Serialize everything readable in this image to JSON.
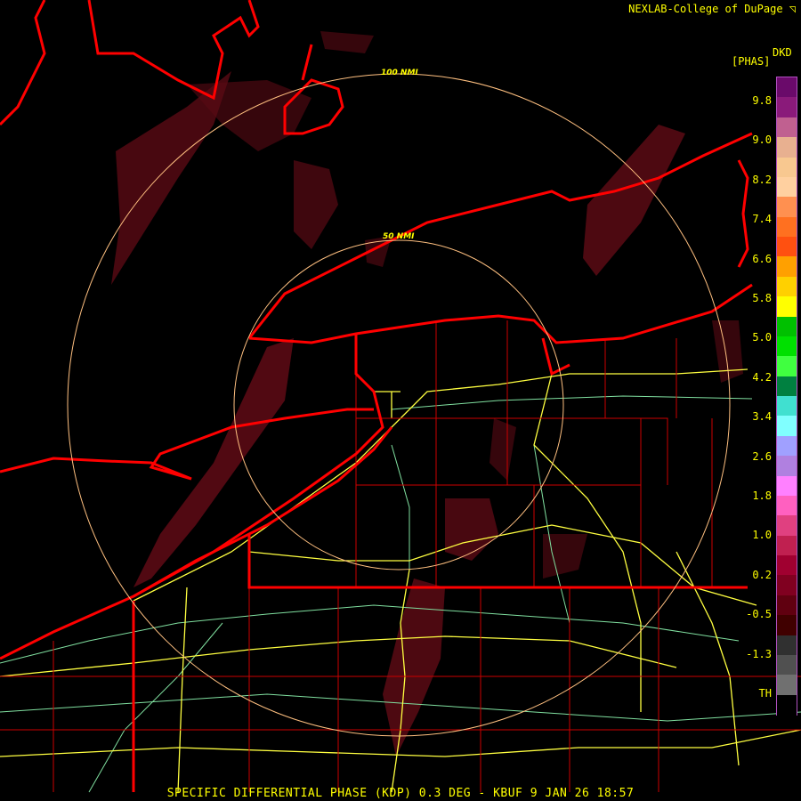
{
  "header": {
    "credit": "NEXLAB-College of DuPage ◹"
  },
  "legend": {
    "unit_top": "DKD",
    "unit_sub": "[PHAS]",
    "labels": [
      "9.8",
      "9.0",
      "8.2",
      "7.4",
      "6.6",
      "5.8",
      "5.0",
      "4.2",
      "3.4",
      "2.6",
      "1.8",
      "1.0",
      "0.2",
      "-0.5",
      "-1.3",
      "TH"
    ],
    "colors": [
      "#6a0a6a",
      "#8a1a7a",
      "#c06090",
      "#e8b090",
      "#f8c890",
      "#ffd0a0",
      "#ff9050",
      "#ff7020",
      "#ff5010",
      "#ffa000",
      "#ffd000",
      "#ffff00",
      "#00c000",
      "#00e000",
      "#40ff40",
      "#008040",
      "#40e0d0",
      "#80ffff",
      "#a0a0ff",
      "#b080e0",
      "#ff80ff",
      "#ff60c0",
      "#e04080",
      "#c02050",
      "#a00030",
      "#800020",
      "#600010",
      "#400000",
      "#303030",
      "#505050",
      "#707070",
      "#000000"
    ]
  },
  "range_rings": {
    "inner": "50 NMI",
    "outer": "100 NMI"
  },
  "title": "SPECIFIC DIFFERENTIAL PHASE (KDP) 0.3 DEG - KBUF 9 JAN 26 18:57",
  "colors": {
    "boundary": "#ff0000",
    "county": "#cc0000",
    "highway": "#ffff40",
    "road": "#80e0a0",
    "ring": "#ffc080",
    "echo": "#5a0a14"
  }
}
